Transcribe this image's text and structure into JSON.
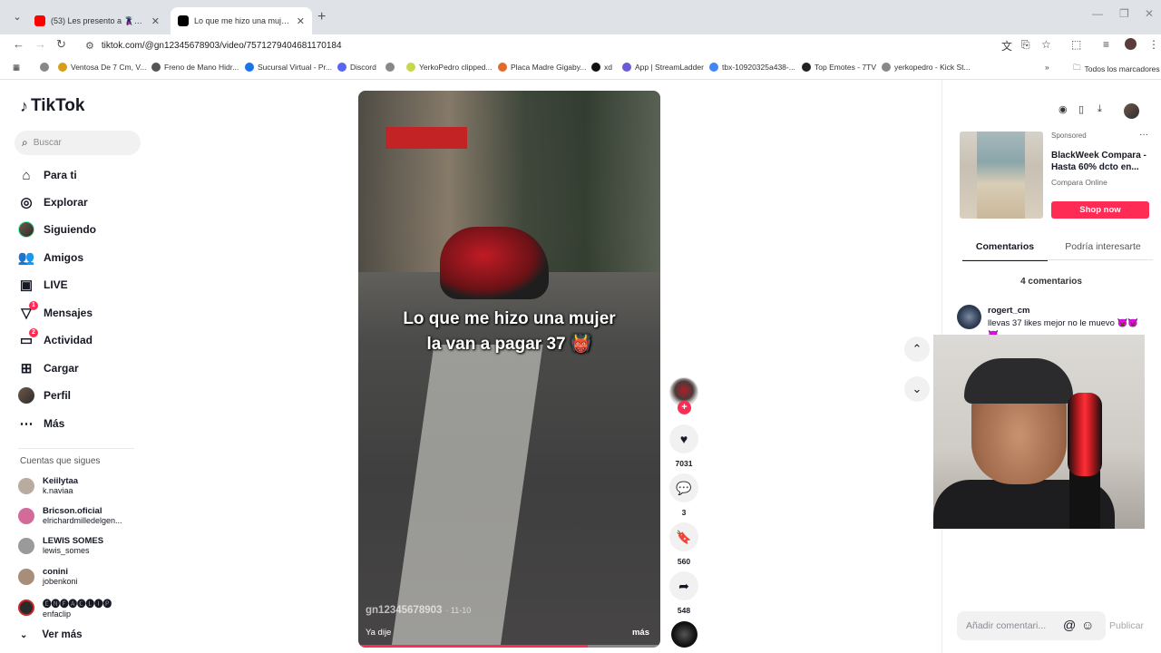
{
  "browser": {
    "tabs": [
      {
        "title": "(53) Les presento a 🦹Mi mejo",
        "favicon_color": "#ff0000",
        "active": false
      },
      {
        "title": "Lo que me hizo una mujer 37 💀",
        "favicon_color": "#000000",
        "active": true
      }
    ],
    "url": "tiktok.com/@gn12345678903/video/7571279404681170184",
    "bookmarks": [
      {
        "label": "Ventosa De 7 Cm, V..."
      },
      {
        "label": "Freno de Mano Hidr..."
      },
      {
        "label": "Sucursal Virtual - Pr..."
      },
      {
        "label": "Discord"
      },
      {
        "label": ""
      },
      {
        "label": "YerkoPedro clipped..."
      },
      {
        "label": "Placa Madre Gigaby..."
      },
      {
        "label": "xd"
      },
      {
        "label": "App | StreamLadder"
      },
      {
        "label": "tbx-10920325a438-..."
      },
      {
        "label": "Top Emotes - 7TV"
      },
      {
        "label": "yerkopedro - Kick St..."
      }
    ],
    "all_bookmarks": "Todos los marcadores"
  },
  "tiktok": {
    "logo": "TikTok",
    "search_placeholder": "Buscar",
    "nav": [
      {
        "label": "Para ti",
        "icon": "home-icon"
      },
      {
        "label": "Explorar",
        "icon": "compass-icon"
      },
      {
        "label": "Siguiendo",
        "icon": "following-avatar"
      },
      {
        "label": "Amigos",
        "icon": "friends-icon"
      },
      {
        "label": "LIVE",
        "icon": "live-icon"
      },
      {
        "label": "Mensajes",
        "icon": "messages-icon",
        "badge": "1"
      },
      {
        "label": "Actividad",
        "icon": "activity-icon",
        "badge": "2"
      },
      {
        "label": "Cargar",
        "icon": "upload-icon"
      },
      {
        "label": "Perfil",
        "icon": "profile-avatar"
      },
      {
        "label": "Más",
        "icon": "more-icon"
      }
    ],
    "following_title": "Cuentas que sigues",
    "following": [
      {
        "name": "Keiilytaa",
        "username": "k.naviaa",
        "color": "#b8aca0"
      },
      {
        "name": "Bricson.oficial",
        "username": "elrichardmilledelgen...",
        "color": "#d36b9a"
      },
      {
        "name": "LEWIS SOMES",
        "username": "lewis_somes",
        "color": "#9a9a9a"
      },
      {
        "name": "conini",
        "username": "jobenkoni",
        "color": "#a88d78"
      },
      {
        "name": "🅔🅝🅕🅐🅒🅛🅘🅟",
        "username": "enfaclip",
        "color": "#2a2a2a"
      }
    ],
    "see_more": "Ver más"
  },
  "video": {
    "caption_line1": "Lo que me hizo una mujer",
    "caption_line2": "la van a pagar 37 👹",
    "author": "gn12345678903",
    "date": "· 11-10",
    "description": "Ya dije",
    "more": "más",
    "progress_fraction": 0.76,
    "likes": "7031",
    "comments": "3",
    "saves": "560",
    "shares": "548"
  },
  "right_panel": {
    "ad": {
      "sponsored": "Sponsored",
      "title": "BlackWeek Compara - Hasta 60% dcto en...",
      "brand": "Compara Online",
      "cta": "Shop now"
    },
    "tabs": [
      "Comentarios",
      "Podría interesarte"
    ],
    "comment_count": "4 comentarios",
    "comment": {
      "user": "rogert_cm",
      "text": "llevas 37 likes mejor no le muevo 👿👿",
      "text2": "👿"
    },
    "input_placeholder": "Añadir comentari...",
    "post": "Publicar"
  }
}
